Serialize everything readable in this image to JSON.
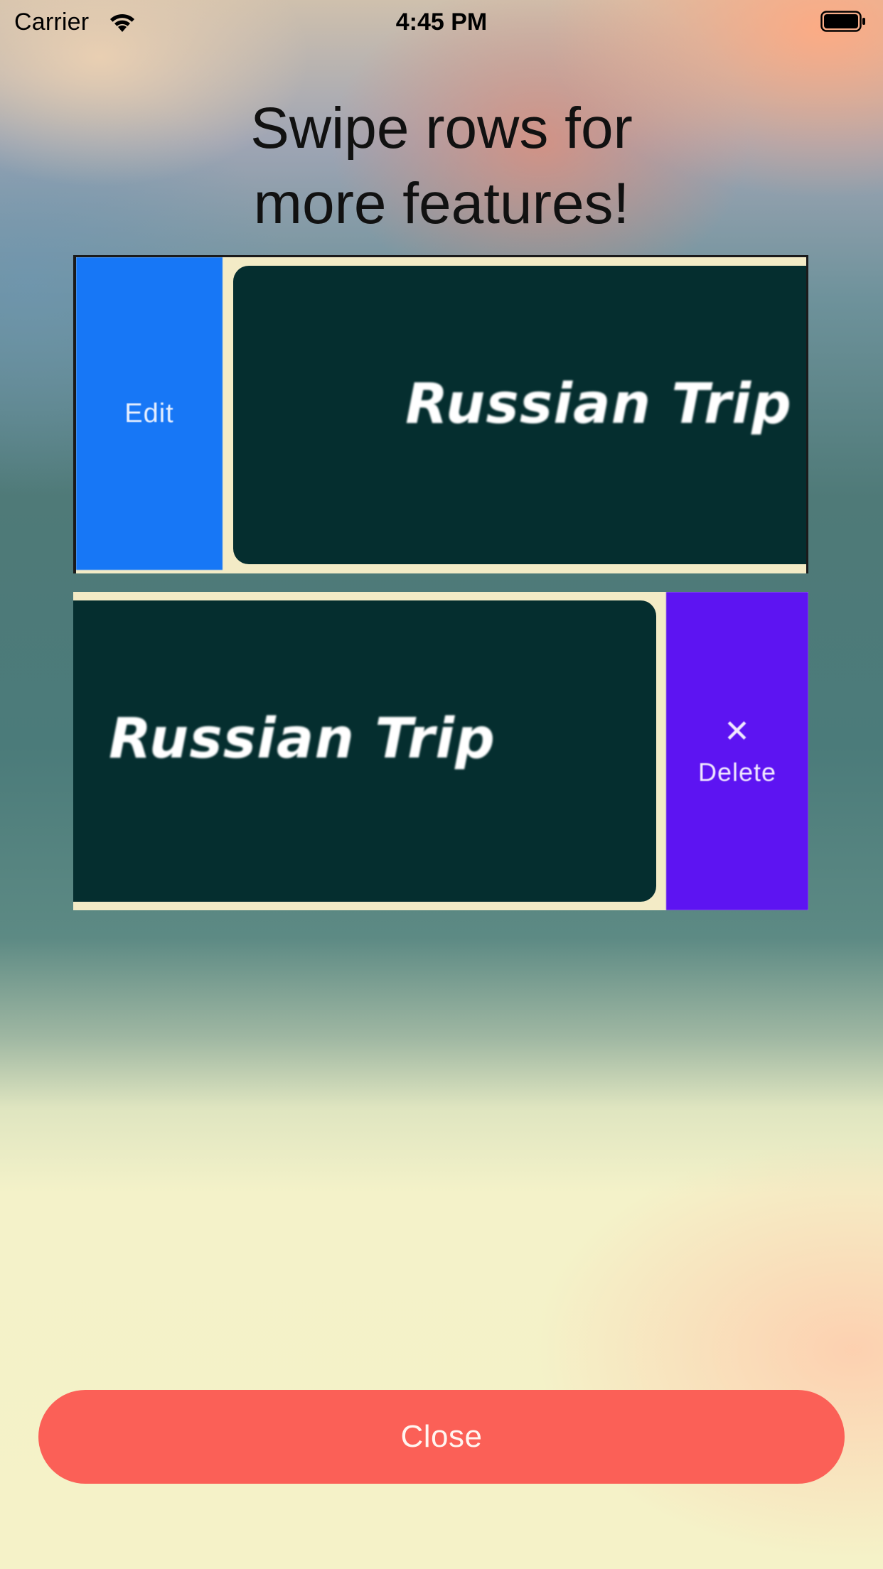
{
  "status_bar": {
    "carrier": "Carrier",
    "time": "4:45 PM",
    "wifi_icon": "wifi-icon",
    "battery_icon": "battery-full-icon"
  },
  "title": {
    "line1": "Swipe rows for",
    "line2": "more features!"
  },
  "examples": [
    {
      "action_label": "Edit",
      "trip_name": "Russian Trip",
      "action_color": "#1777f6"
    },
    {
      "action_label": "Delete",
      "action_icon": "close-x-icon",
      "action_icon_glyph": "✕",
      "trip_name": "Russian Trip",
      "action_color": "#5d14f2"
    }
  ],
  "colors": {
    "trip_panel": "#052e2f",
    "card_background": "#f3ebc6",
    "close_button": "#fb6057"
  },
  "close_button": {
    "label": "Close"
  }
}
